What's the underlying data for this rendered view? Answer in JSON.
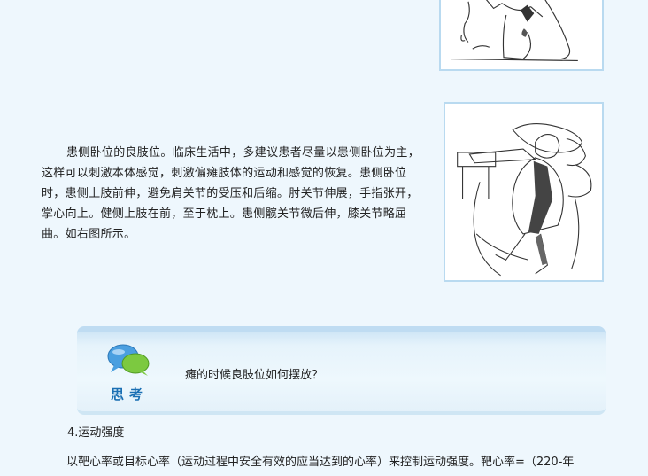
{
  "paragraph": "患侧卧位的良肢位。临床生活中，多建议患者尽量以患侧卧位为主，这样可以刺激本体感觉，刺激偏瘫肢体的运动和感觉的恢复。患侧卧位时，患侧上肢前伸，避免肩关节的受压和后缩。肘关节伸展，手指张开，掌心向上。健侧上肢在前，至于枕上。患侧髋关节微后伸，膝关节略屈曲。如右图所示。",
  "think": {
    "label": "思考",
    "question": "瘫的时候良肢位如何摆放？",
    "icon": "speech-bubbles-icon"
  },
  "section_heading": "4.运动强度",
  "body_line": "以靶心率或目标心率（运动过程中安全有效的应当达到的心率）来控制运动强度。靶心率=（220-年"
}
